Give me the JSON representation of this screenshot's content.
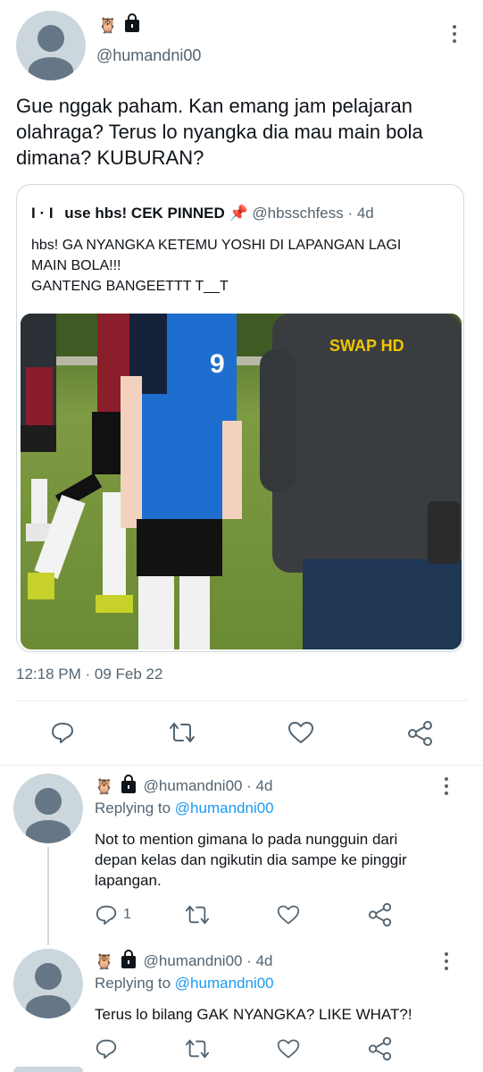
{
  "main_tweet": {
    "handle": "@humandni00",
    "emoji": "🦉",
    "text": "Gue nggak paham. Kan emang jam pelajaran olahraga? Terus lo nyangka dia mau main bola dimana? KUBURAN?",
    "timestamp": "12:18 PM · 09 Feb 22"
  },
  "quote": {
    "name_prefix": "I · I",
    "name": "use hbs! CEK PINNED",
    "pin_emoji": "📌",
    "handle": "@hbsschfess",
    "age": "· 4d",
    "text_lines": [
      "hbs! GA NYANGKA KETEMU YOSHI DI LAPANGAN LAGI",
      "MAIN BOLA!!!",
      "GANTENG BANGEETTT T__T"
    ],
    "jersey_number": "9",
    "shirt_text": "SWAP HD"
  },
  "replies": [
    {
      "emoji": "🦉",
      "handle": "@humandni00",
      "age": "· 4d",
      "replying_label": "Replying to",
      "replying_handle": "@humandni00",
      "text": "Not to mention gimana lo pada nungguin dari depan kelas dan ngikutin dia sampe ke pinggir lapangan.",
      "reply_count": "1"
    },
    {
      "emoji": "🦉",
      "handle": "@humandni00",
      "age": "· 4d",
      "replying_label": "Replying to",
      "replying_handle": "@humandni00",
      "text": "Terus lo bilang GAK NYANGKA? LIKE WHAT?!",
      "reply_count": ""
    }
  ],
  "icons": [
    "reply-icon",
    "retweet-icon",
    "like-icon",
    "share-icon",
    "more-icon",
    "lock-icon",
    "owl-emoji"
  ]
}
